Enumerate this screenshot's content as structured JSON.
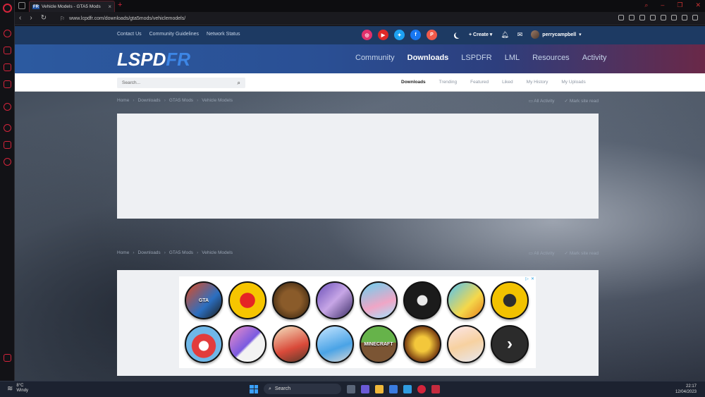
{
  "browser": {
    "tab_title": "Vehicle Models - GTA5 Mods",
    "tab_favicon": "FR",
    "url": "www.lcpdfr.com/downloads/gta5mods/vehiclemodels/"
  },
  "topbar": {
    "links": [
      "Contact Us",
      "Community Guidelines",
      "Network Status"
    ],
    "socials": [
      {
        "name": "instagram-icon",
        "glyph": "◎",
        "color": "#e1306c"
      },
      {
        "name": "youtube-icon",
        "glyph": "▶",
        "color": "#e02828"
      },
      {
        "name": "twitter-icon",
        "glyph": "✦",
        "color": "#1da1f2"
      },
      {
        "name": "facebook-icon",
        "glyph": "f",
        "color": "#1877f2"
      },
      {
        "name": "patreon-icon",
        "glyph": "P",
        "color": "#f05a4a"
      }
    ],
    "create_label": "Create",
    "username": "perrycampbell"
  },
  "logo": {
    "part1": "LSPD",
    "part2": "FR"
  },
  "mainnav": [
    "Community",
    "Downloads",
    "LSPDFR",
    "LML",
    "Resources",
    "Activity"
  ],
  "mainnav_active": "Downloads",
  "search": {
    "placeholder": "Search..."
  },
  "subtabs": [
    "Downloads",
    "Trending",
    "Featured",
    "Liked",
    "My History",
    "My Uploads"
  ],
  "breadcrumbs": [
    "Home",
    "Downloads",
    "GTA5 Mods",
    "Vehicle Models"
  ],
  "breadcrumb_actions": [
    "All Activity",
    "Mark site read"
  ],
  "games": [
    {
      "label": "GTA",
      "bg": "linear-gradient(135deg,#e24a1f,#2b6fc1 60%,#1c1c1c)"
    },
    {
      "label": "",
      "bg": "radial-gradient(circle at 50% 50%,#e52525 30%,#f6c500 31%)"
    },
    {
      "label": "",
      "bg": "radial-gradient(circle,#8a5b2a 40%,#3b2610 90%)"
    },
    {
      "label": "",
      "bg": "linear-gradient(135deg,#6a4fb8,#c7a6e6 50%,#3a2c66)"
    },
    {
      "label": "",
      "bg": "linear-gradient(160deg,#6ad0f0,#f0a6c6 60%,#a2e4ff)"
    },
    {
      "label": "",
      "bg": "radial-gradient(circle,#eaeaea 20%,#1b1b1b 22%)"
    },
    {
      "label": "",
      "bg": "linear-gradient(135deg,#4fc3f7,#f5d84a 60%,#e57d1c)"
    },
    {
      "label": "",
      "bg": "radial-gradient(circle,#2e2e2e 25%,#f2c200 27%)"
    },
    {
      "label": "",
      "bg": "radial-gradient(circle at 50% 55%,#ffffff 18%,#e23c3c 20%,#e23c3c 45%,#6fb7e8 47%)"
    },
    {
      "label": "",
      "bg": "linear-gradient(135deg,#f090c8,#7a5ae0 50%,#f3f3f3 55%)"
    },
    {
      "label": "",
      "bg": "linear-gradient(160deg,#f5e2c0,#d94a3a 60%,#5a3a2a)"
    },
    {
      "label": "",
      "bg": "linear-gradient(160deg,#c6e5ff,#4aa3e6 60%,#d7d7d7)"
    },
    {
      "label": "MINECRAFT",
      "bg": "linear-gradient(180deg,#66b34a 45%,#7b5534 46%)"
    },
    {
      "label": "",
      "bg": "radial-gradient(circle,#f3c73b 30%,#7a3f12 70%)"
    },
    {
      "label": "",
      "bg": "linear-gradient(160deg,#fbe6e9,#f7d1a0 50%,#e7e7ef)"
    }
  ],
  "taskbar": {
    "temp": "8°C",
    "condition": "Windy",
    "search_label": "Search",
    "time": "22:17",
    "date": "12/04/2023"
  }
}
